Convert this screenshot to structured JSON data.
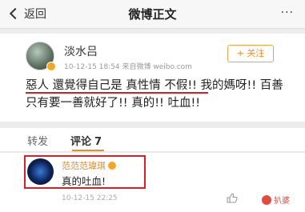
{
  "nav": {
    "back_label": "返回",
    "title": "微博正文",
    "more_label": "···"
  },
  "post": {
    "username": "淡水吕",
    "meta": "10-12-15 18:54  来自微博 weibo.com",
    "follow_label": "+ 关注",
    "text": "惡人 還覺得自己是 真性情  不假!! 我的媽呀!! 百善 只有要一善就好了!! 真的!! 吐血!!"
  },
  "tabs": {
    "repost_label": "转发",
    "comment_label": "评论",
    "comment_count": "7"
  },
  "comment": {
    "name": "范范范瑋琪",
    "text": "真的吐血!",
    "time": "10-12-15 22:25"
  },
  "watermark": {
    "text": "扒婆"
  },
  "colors": {
    "accent": "#f08d27",
    "highlight_red": "#d8202a"
  },
  "icons": [
    "chevron-left-icon",
    "more-icon",
    "verified-badge-icon",
    "like-icon"
  ]
}
